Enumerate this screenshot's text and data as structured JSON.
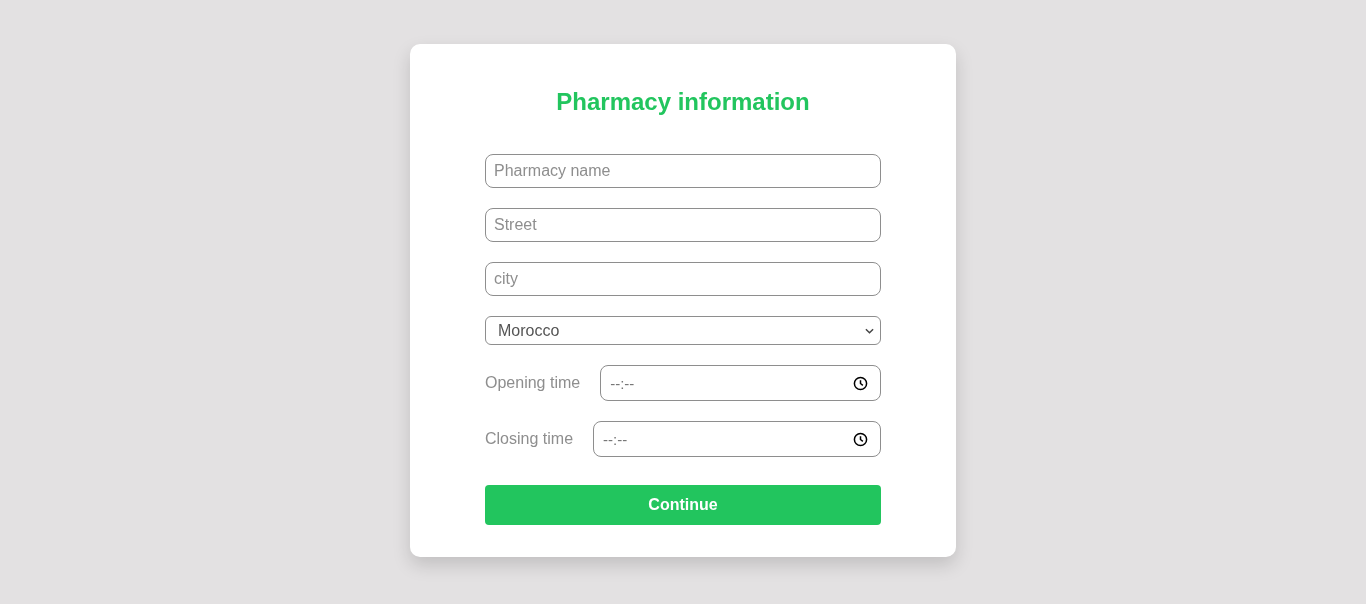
{
  "title": "Pharmacy information",
  "fields": [
    {
      "kind": "text",
      "placeholder": "Pharmacy name"
    },
    {
      "kind": "text",
      "placeholder": "Street"
    },
    {
      "kind": "text",
      "placeholder": "city"
    },
    {
      "kind": "select",
      "value": "Morocco"
    },
    {
      "kind": "time",
      "label": "Opening time",
      "placeholder": "--:--"
    },
    {
      "kind": "time",
      "label": "Closing time",
      "placeholder": "--:--"
    }
  ],
  "button": "Continue"
}
